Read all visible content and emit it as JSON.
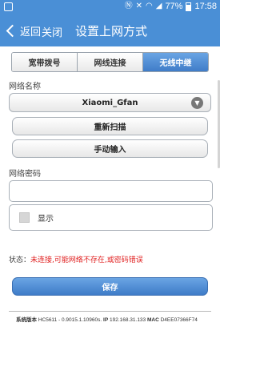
{
  "statusbar": {
    "battery": "77%",
    "time": "17:58"
  },
  "header": {
    "back_label": "返回",
    "close_label": "关闭",
    "title": "设置上网方式"
  },
  "tabs": [
    {
      "label": "宽带拨号"
    },
    {
      "label": "网线连接"
    },
    {
      "label": "无线中继"
    }
  ],
  "network": {
    "name_label": "网络名称",
    "selected": "Xiaomi_Gfan",
    "rescan_label": "重新扫描",
    "manual_label": "手动输入"
  },
  "password": {
    "label": "网络密码",
    "value": "",
    "show_label": "显示"
  },
  "status": {
    "prefix": "状态：",
    "message": "未连接,可能网络不存在,或密码错误"
  },
  "save_label": "保存",
  "sysinfo": {
    "version_label": "系统版本",
    "version_value": "HC5611 - 0.9015.1.10960s.",
    "ip_label": "IP",
    "ip_value": "192.168.31.133",
    "mac_label": "MAC",
    "mac_value": "D4EE07366F74"
  },
  "colors": {
    "accent": "#4a8fd6",
    "error": "#e02020"
  },
  "icons": [
    "notification-icon",
    "nfc-icon",
    "mute-icon",
    "wifi-icon",
    "signal-icon",
    "battery-icon",
    "back-chevron-icon",
    "dropdown-icon"
  ]
}
